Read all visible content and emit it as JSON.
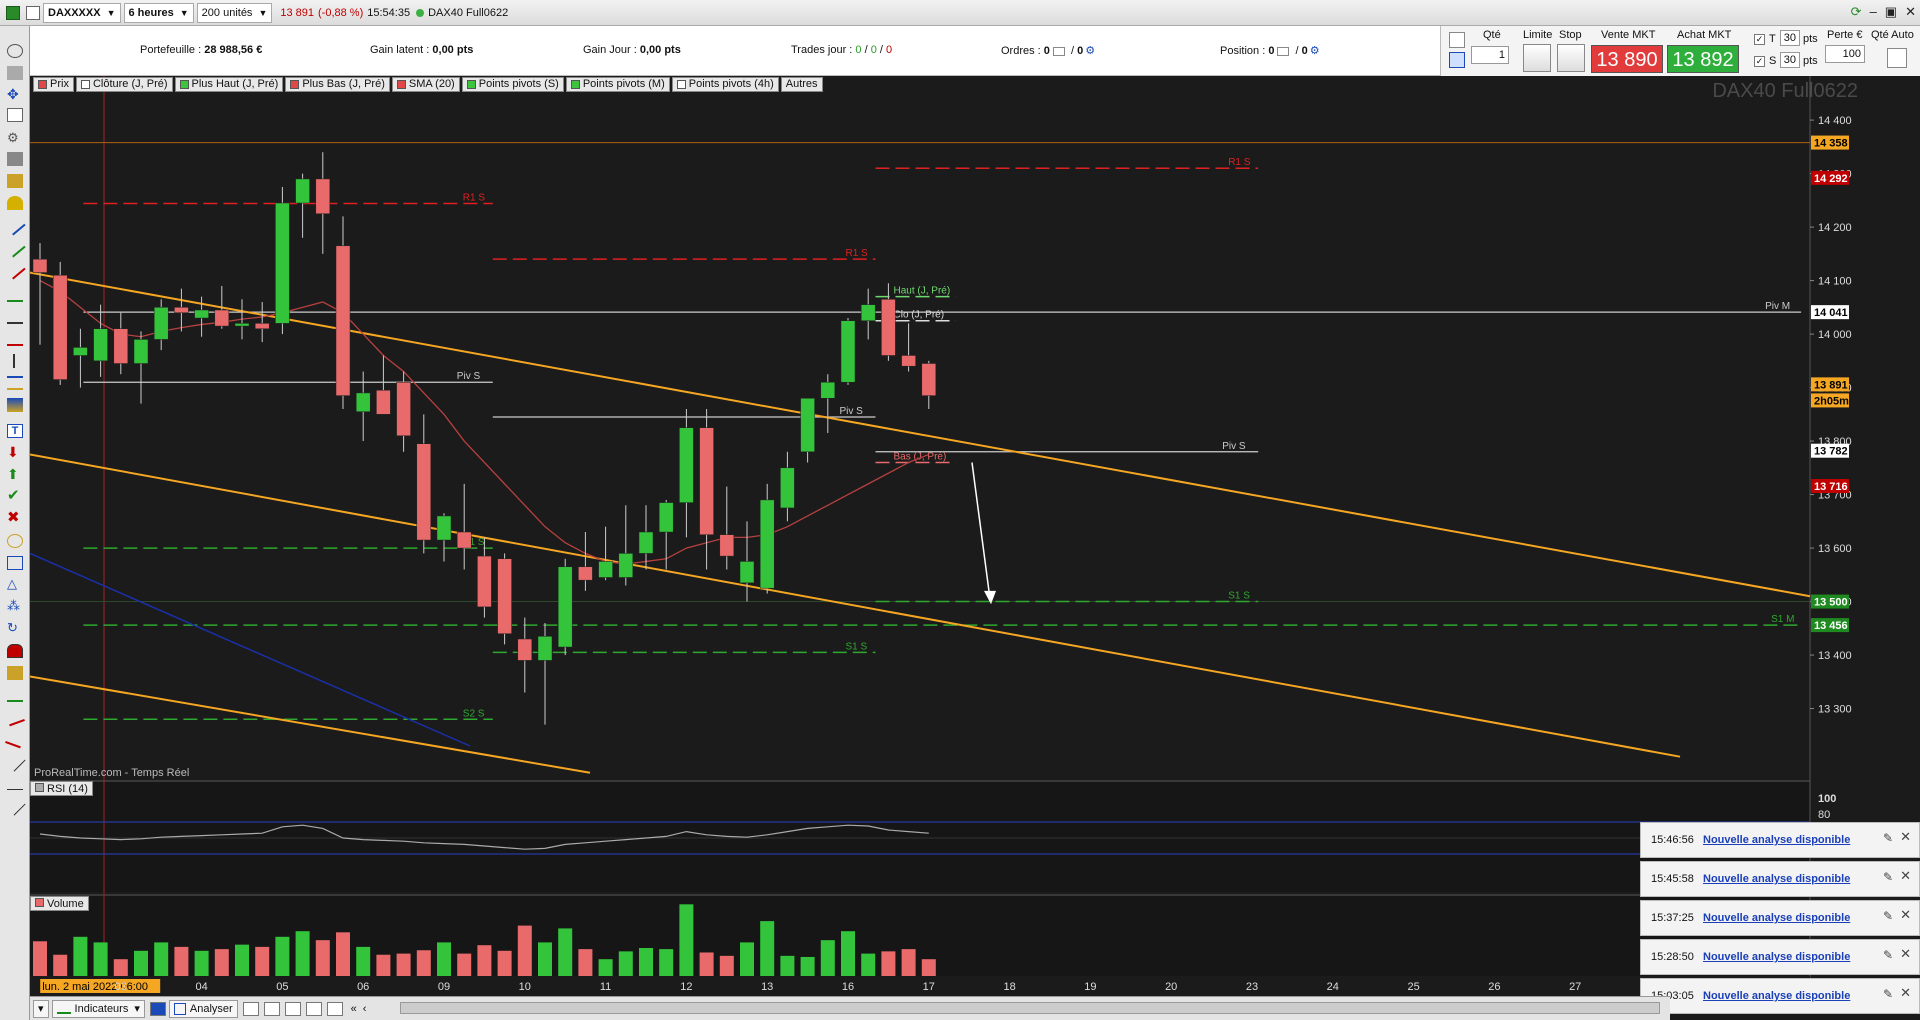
{
  "toolbar": {
    "instrument": "DAXXXXX",
    "timeframe": "6 heures",
    "units": "200 unités",
    "price": "13 891",
    "change": "(-0,88 %)",
    "time": "15:54:35",
    "contract": "DAX40 Full0622"
  },
  "info": {
    "portefeuille_label": "Portefeuille :",
    "portefeuille_value": "28 988,56 €",
    "gain_latent_label": "Gain latent :",
    "gain_latent_value": "0,00 pts",
    "gain_jour_label": "Gain Jour :",
    "gain_jour_value": "0,00 pts",
    "trades_label": "Trades jour :",
    "trades_a": "0",
    "trades_b": "0",
    "trades_c": "0",
    "ordres_label": "Ordres :",
    "ordres_a": "0",
    "ordres_b": "0",
    "position_label": "Position :",
    "position_a": "0",
    "position_b": "0"
  },
  "order_panel": {
    "qte_label": "Qté",
    "qte_value": "1",
    "limite_label": "Limite",
    "stop_label": "Stop",
    "vente_label": "Vente MKT",
    "vente_price": "13 890",
    "achat_label": "Achat MKT",
    "achat_price": "13 892",
    "t_label": "T",
    "t_value": "30",
    "s_label": "S",
    "s_value": "30",
    "pts": "pts",
    "perte_label": "Perte €",
    "perte_value": "100",
    "qte_auto_label": "Qté Auto"
  },
  "indicator_tabs": [
    {
      "label": "Prix",
      "color": "#e04848"
    },
    {
      "label": "Clôture (J, Pré)",
      "color": "#ffffff"
    },
    {
      "label": "Plus Haut (J, Pré)",
      "color": "#3cc43c"
    },
    {
      "label": "Plus Bas (J, Pré)",
      "color": "#e04848"
    },
    {
      "label": "SMA (20)",
      "color": "#e04848"
    },
    {
      "label": "Points pivots (S)",
      "color": "#3cc43c"
    },
    {
      "label": "Points pivots (M)",
      "color": "#3cc43c"
    },
    {
      "label": "Points pivots (4h)",
      "color": "#ffffff"
    },
    {
      "label": "Autres",
      "color": ""
    }
  ],
  "watermark": "DAX40 Full0622",
  "source": "ProRealTime.com - Temps Réel",
  "rsi_label": "RSI (14)",
  "volume_label": "Volume",
  "colors": {
    "up": "#33c43c",
    "down": "#e86a6a",
    "trend": "#f5a623",
    "bg": "#1b1b1b"
  },
  "chart_data": {
    "type": "candlestick",
    "y_ticks": [
      "14 400",
      "14 300",
      "14 200",
      "14 100",
      "14 000",
      "13 900",
      "13 800",
      "13 700",
      "13 600",
      "13 500",
      "13 400",
      "13 300"
    ],
    "ylim": [
      13230,
      14460
    ],
    "price_tags": [
      {
        "text": "14 358",
        "value": 14358,
        "bg": "#f5a623",
        "fg": "#000"
      },
      {
        "text": "14 292",
        "value": 14292,
        "bg": "#c00000",
        "fg": "#fff"
      },
      {
        "text": "14 041",
        "value": 14041,
        "bg": "#ffffff",
        "fg": "#000"
      },
      {
        "text": "13 891",
        "value": 13906,
        "bg": "#f5a623",
        "fg": "#000"
      },
      {
        "text": "2h05m",
        "value": 13876,
        "bg": "#f5a623",
        "fg": "#000"
      },
      {
        "text": "13 782",
        "value": 13782,
        "bg": "#ffffff",
        "fg": "#000"
      },
      {
        "text": "13 716",
        "value": 13716,
        "bg": "#c00000",
        "fg": "#fff"
      },
      {
        "text": "13 500",
        "value": 13500,
        "bg": "#1f8a1f",
        "fg": "#fff"
      },
      {
        "text": "13 456",
        "value": 13456,
        "bg": "#1f8a1f",
        "fg": "#fff"
      }
    ],
    "x_labels": [
      {
        "text": "lun. 2 mai 2022 06:00",
        "idx": 1
      },
      {
        "text": "03",
        "idx": 4
      },
      {
        "text": "04",
        "idx": 8
      },
      {
        "text": "05",
        "idx": 12
      },
      {
        "text": "06",
        "idx": 16
      },
      {
        "text": "09",
        "idx": 20
      },
      {
        "text": "10",
        "idx": 24
      },
      {
        "text": "11",
        "idx": 28
      },
      {
        "text": "12",
        "idx": 32
      },
      {
        "text": "13",
        "idx": 36
      },
      {
        "text": "16",
        "idx": 40
      },
      {
        "text": "17",
        "idx": 44
      },
      {
        "text": "18",
        "idx": 48
      },
      {
        "text": "19",
        "idx": 52
      },
      {
        "text": "20",
        "idx": 56
      },
      {
        "text": "23",
        "idx": 60
      },
      {
        "text": "24",
        "idx": 64
      },
      {
        "text": "25",
        "idx": 68
      },
      {
        "text": "26",
        "idx": 72
      },
      {
        "text": "27",
        "idx": 76
      }
    ],
    "candles": [
      {
        "o": 14140,
        "h": 14170,
        "l": 13980,
        "c": 14115
      },
      {
        "o": 14110,
        "h": 14135,
        "l": 13905,
        "c": 13915
      },
      {
        "o": 13960,
        "h": 14010,
        "l": 13900,
        "c": 13975
      },
      {
        "o": 13950,
        "h": 14055,
        "l": 13920,
        "c": 14010
      },
      {
        "o": 14010,
        "h": 14040,
        "l": 13925,
        "c": 13945
      },
      {
        "o": 13945,
        "h": 14005,
        "l": 13870,
        "c": 13990
      },
      {
        "o": 13990,
        "h": 14065,
        "l": 13970,
        "c": 14050
      },
      {
        "o": 14050,
        "h": 14085,
        "l": 14005,
        "c": 14040
      },
      {
        "o": 14030,
        "h": 14070,
        "l": 13995,
        "c": 14045
      },
      {
        "o": 14045,
        "h": 14090,
        "l": 14010,
        "c": 14015
      },
      {
        "o": 14015,
        "h": 14065,
        "l": 13990,
        "c": 14020
      },
      {
        "o": 14020,
        "h": 14060,
        "l": 13985,
        "c": 14010
      },
      {
        "o": 14020,
        "h": 14275,
        "l": 14000,
        "c": 14245
      },
      {
        "o": 14245,
        "h": 14300,
        "l": 14180,
        "c": 14290
      },
      {
        "o": 14290,
        "h": 14340,
        "l": 14150,
        "c": 14225
      },
      {
        "o": 14165,
        "h": 14220,
        "l": 13860,
        "c": 13885
      },
      {
        "o": 13855,
        "h": 13930,
        "l": 13800,
        "c": 13890
      },
      {
        "o": 13895,
        "h": 13960,
        "l": 13855,
        "c": 13850
      },
      {
        "o": 13910,
        "h": 13930,
        "l": 13780,
        "c": 13810
      },
      {
        "o": 13795,
        "h": 13850,
        "l": 13590,
        "c": 13615
      },
      {
        "o": 13615,
        "h": 13665,
        "l": 13575,
        "c": 13660
      },
      {
        "o": 13630,
        "h": 13720,
        "l": 13560,
        "c": 13600
      },
      {
        "o": 13585,
        "h": 13620,
        "l": 13470,
        "c": 13490
      },
      {
        "o": 13580,
        "h": 13590,
        "l": 13420,
        "c": 13440
      },
      {
        "o": 13430,
        "h": 13470,
        "l": 13330,
        "c": 13390
      },
      {
        "o": 13390,
        "h": 13460,
        "l": 13270,
        "c": 13435
      },
      {
        "o": 13415,
        "h": 13580,
        "l": 13400,
        "c": 13565
      },
      {
        "o": 13565,
        "h": 13630,
        "l": 13520,
        "c": 13540
      },
      {
        "o": 13545,
        "h": 13640,
        "l": 13540,
        "c": 13575
      },
      {
        "o": 13545,
        "h": 13680,
        "l": 13530,
        "c": 13590
      },
      {
        "o": 13590,
        "h": 13680,
        "l": 13560,
        "c": 13630
      },
      {
        "o": 13630,
        "h": 13690,
        "l": 13560,
        "c": 13685
      },
      {
        "o": 13685,
        "h": 13860,
        "l": 13620,
        "c": 13825
      },
      {
        "o": 13825,
        "h": 13860,
        "l": 13560,
        "c": 13625
      },
      {
        "o": 13625,
        "h": 13715,
        "l": 13560,
        "c": 13585
      },
      {
        "o": 13535,
        "h": 13650,
        "l": 13500,
        "c": 13575
      },
      {
        "o": 13525,
        "h": 13720,
        "l": 13515,
        "c": 13690
      },
      {
        "o": 13675,
        "h": 13780,
        "l": 13650,
        "c": 13750
      },
      {
        "o": 13780,
        "h": 13880,
        "l": 13760,
        "c": 13880
      },
      {
        "o": 13880,
        "h": 13925,
        "l": 13815,
        "c": 13910
      },
      {
        "o": 13910,
        "h": 14030,
        "l": 13905,
        "c": 14025
      },
      {
        "o": 14025,
        "h": 14085,
        "l": 13990,
        "c": 14055
      },
      {
        "o": 14065,
        "h": 14095,
        "l": 13950,
        "c": 13960
      },
      {
        "o": 13960,
        "h": 14020,
        "l": 13930,
        "c": 13940
      },
      {
        "o": 13945,
        "h": 13950,
        "l": 13860,
        "c": 13885
      }
    ],
    "sma": [
      14100,
      14080,
      14050,
      14020,
      14000,
      13995,
      14005,
      14012,
      14018,
      14022,
      14028,
      14032,
      14040,
      14050,
      14060,
      14040,
      14000,
      13960,
      13930,
      13890,
      13850,
      13800,
      13760,
      13720,
      13680,
      13640,
      13610,
      13590,
      13575,
      13570,
      13575,
      13580,
      13600,
      13610,
      13620,
      13620,
      13625,
      13640,
      13660,
      13680,
      13700,
      13720,
      13740,
      13760,
      13775
    ],
    "levels": [
      {
        "label": "R1 S",
        "value": 14244,
        "color": "#e02020",
        "x0": 0.03,
        "x1": 0.26,
        "dash": true
      },
      {
        "label": "R1 S",
        "value": 14140,
        "color": "#e02020",
        "x0": 0.26,
        "x1": 0.475,
        "dash": true
      },
      {
        "label": "R1 S",
        "value": 14310,
        "color": "#e02020",
        "x0": 0.475,
        "x1": 0.69,
        "dash": true
      },
      {
        "label": "Piv S",
        "value": 13910,
        "color": "#cccccc",
        "x0": 0.03,
        "x1": 0.26,
        "dash": false
      },
      {
        "label": "Piv S",
        "value": 13845,
        "color": "#cccccc",
        "x0": 0.26,
        "x1": 0.475,
        "dash": false
      },
      {
        "label": "Piv S",
        "value": 13780,
        "color": "#cccccc",
        "x0": 0.475,
        "x1": 0.69,
        "dash": false
      },
      {
        "label": "Piv M",
        "value": 14041,
        "color": "#cccccc",
        "x0": 0.03,
        "x1": 0.995,
        "dash": false
      },
      {
        "label": "S1 S",
        "value": 13600,
        "color": "#2ea82e",
        "x0": 0.03,
        "x1": 0.26,
        "dash": true
      },
      {
        "label": "S1 S",
        "value": 13405,
        "color": "#2ea82e",
        "x0": 0.26,
        "x1": 0.475,
        "dash": true
      },
      {
        "label": "S1 S",
        "value": 13500,
        "color": "#2ea82e",
        "x0": 0.475,
        "x1": 0.69,
        "dash": true
      },
      {
        "label": "S1 M",
        "value": 13456,
        "color": "#2ea82e",
        "x0": 0.03,
        "x1": 0.995,
        "dash": true
      },
      {
        "label": "S2 S",
        "value": 13280,
        "color": "#2ea82e",
        "x0": 0.03,
        "x1": 0.26,
        "dash": true
      },
      {
        "label": "Haut (J, Pré)",
        "value": 14070,
        "color": "#6fd86f",
        "x0": 0.475,
        "x1": 0.52,
        "dash": true
      },
      {
        "label": "Clo (J, Pré)",
        "value": 14025,
        "color": "#dddddd",
        "x0": 0.475,
        "x1": 0.52,
        "dash": true
      },
      {
        "label": "Bas (J, Pré)",
        "value": 13760,
        "color": "#e86a6a",
        "x0": 0.475,
        "x1": 0.52,
        "dash": true
      }
    ],
    "rsi": [
      55,
      52,
      50,
      49,
      48,
      49,
      51,
      52,
      53,
      54,
      55,
      56,
      64,
      66,
      62,
      50,
      48,
      47,
      46,
      44,
      43,
      42,
      40,
      38,
      36,
      37,
      42,
      44,
      46,
      48,
      50,
      52,
      58,
      54,
      52,
      51,
      54,
      58,
      62,
      64,
      66,
      65,
      60,
      58,
      56
    ],
    "volume": [
      62,
      38,
      70,
      60,
      30,
      45,
      60,
      52,
      45,
      48,
      56,
      52,
      70,
      80,
      64,
      78,
      52,
      38,
      40,
      46,
      60,
      40,
      55,
      45,
      90,
      60,
      85,
      48,
      30,
      44,
      50,
      48,
      128,
      42,
      36,
      60,
      98,
      36,
      34,
      64,
      80,
      40,
      44,
      48,
      30
    ]
  },
  "notifications": [
    {
      "time": "15:46:56",
      "text": "Nouvelle analyse disponible"
    },
    {
      "time": "15:45:58",
      "text": "Nouvelle analyse disponible"
    },
    {
      "time": "15:37:25",
      "text": "Nouvelle analyse disponible"
    },
    {
      "time": "15:28:50",
      "text": "Nouvelle analyse disponible"
    },
    {
      "time": "15:03:05",
      "text": "Nouvelle analyse disponible"
    }
  ],
  "bottombar": {
    "indicateurs": "Indicateurs",
    "analyser": "Analyser"
  }
}
